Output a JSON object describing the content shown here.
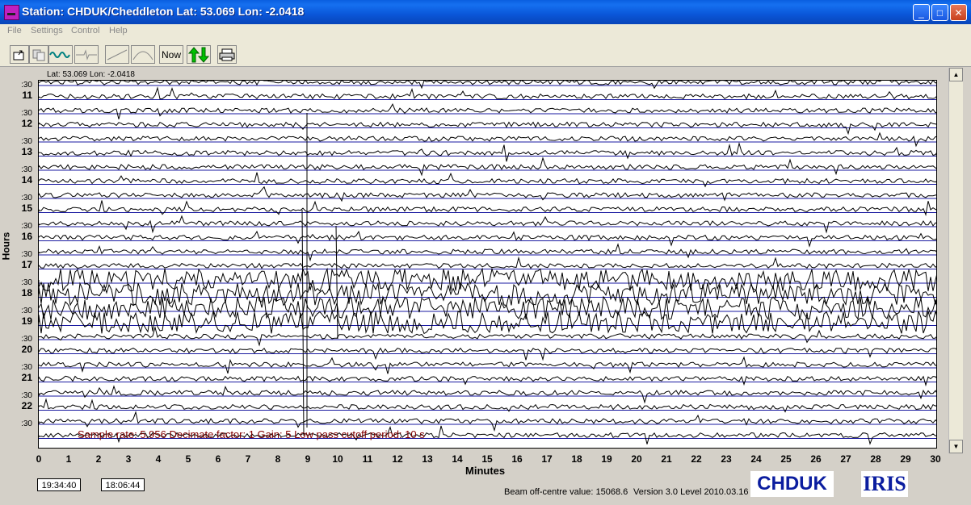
{
  "window": {
    "title": "Station: CHDUK/Cheddleton  Lat: 53.069  Lon: -2.0418",
    "buttons": {
      "minimize": "_",
      "maximize": "□",
      "close": "✕"
    }
  },
  "menu": [
    "File",
    "Settings",
    "Control",
    "Help"
  ],
  "toolbar": {
    "buttons": [
      {
        "name": "open-file-button",
        "icon": "open-icon"
      },
      {
        "name": "copy-button",
        "icon": "copy-icon"
      },
      {
        "name": "waveform-button",
        "icon": "waveform-icon"
      },
      {
        "name": "filter-button",
        "icon": "filter-icon"
      },
      {
        "name": "slope-button",
        "icon": "slope-icon"
      },
      {
        "name": "bandpass-button",
        "icon": "bandpass-icon"
      }
    ],
    "now_label": "Now",
    "arrows_icon": "up-down-arrows-icon",
    "print_icon": "printer-icon"
  },
  "plot": {
    "coord_label": "Lat: 53.069  Lon: -2.0418",
    "y_axis_title": "Hours",
    "hour_labels": [
      "11",
      "12",
      "13",
      "14",
      "15",
      "16",
      "17",
      "18",
      "19",
      "20",
      "21",
      "22"
    ],
    "half_label": ":30",
    "x_ticks": [
      "0",
      "1",
      "2",
      "3",
      "4",
      "5",
      "6",
      "7",
      "8",
      "9",
      "10",
      "11",
      "12",
      "13",
      "14",
      "15",
      "16",
      "17",
      "18",
      "19",
      "20",
      "21",
      "22",
      "23",
      "24",
      "25",
      "26",
      "27",
      "28",
      "29",
      "30"
    ],
    "x_axis_title": "Minutes",
    "info": "Sample rate: 5.956  Decimate factor: 1  Gain: 5  Low pass cutoff period: 10 s"
  },
  "footer": {
    "time_1": "19:34:40",
    "time_2": "18:06:44",
    "beam": "Beam off-centre value: 15068.6",
    "version": "Version 3.0 Level 2010.03.16",
    "station_logo": "CHDUK",
    "iris_logo": "IRIS"
  },
  "colors": {
    "trace": "#000000",
    "baseline": "#1a1aa0",
    "info_text": "#800000",
    "logo": "#0b1d9f"
  }
}
